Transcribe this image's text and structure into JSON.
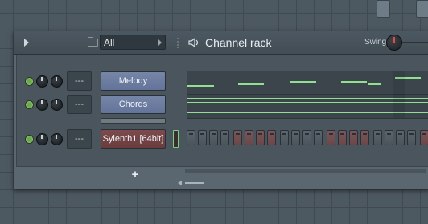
{
  "window": {
    "title": "Channel rack",
    "filter_value": "All",
    "swing_label": "Swing"
  },
  "channels": [
    {
      "name": "Melody",
      "target": "---",
      "color": "#6b7aa0",
      "kind": "pianoroll"
    },
    {
      "name": "Chords",
      "target": "---",
      "color": "#6b7aa0",
      "kind": "pianoroll"
    },
    {
      "name": "Sylenth1 [64bit]",
      "target": "---",
      "color": "#733f42",
      "kind": "steps"
    }
  ],
  "colors": {
    "led_on": "#6aa84f",
    "note": "#90e08f",
    "channel_blue": "#6b7aa0",
    "channel_red": "#733f42",
    "background": "#4d5961"
  },
  "icons": {
    "menu": "triangle-right-icon",
    "folder": "folder-icon",
    "speaker": "speaker-icon",
    "add": "plus-icon"
  },
  "bottom": {
    "add_label": "+"
  }
}
